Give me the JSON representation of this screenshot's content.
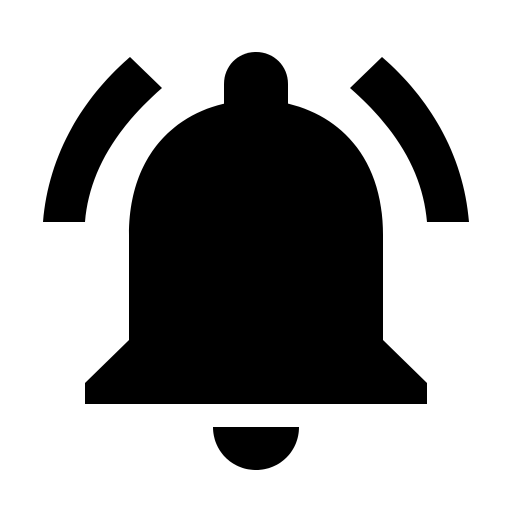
{
  "icon": {
    "name": "bell-ringing-icon",
    "fill_color": "#000000",
    "background_color": "#ffffff"
  }
}
